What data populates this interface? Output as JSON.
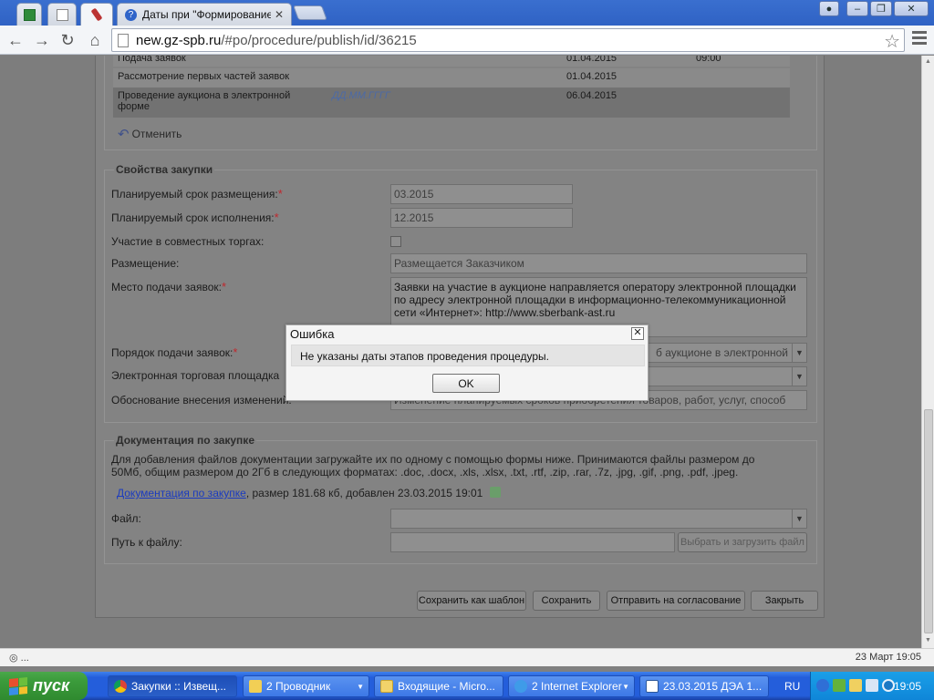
{
  "browser": {
    "tabs": [
      {
        "title": "",
        "icon": "spreadsheet-icon"
      },
      {
        "title": "",
        "icon": "page-icon"
      },
      {
        "title": "",
        "icon": "tools-icon"
      },
      {
        "title": "Даты при \"Формирование и",
        "icon": "help-icon"
      }
    ],
    "url_host": "new.gz-spb.ru",
    "url_path": "/#po/procedure/publish/id/36215"
  },
  "stages": {
    "rows": [
      {
        "name": "Подача заявок",
        "date": "01.04.2015",
        "time": "09:00",
        "selected": false
      },
      {
        "name": "Рассмотрение первых частей заявок",
        "date": "01.04.2015",
        "time": "",
        "selected": false
      },
      {
        "name": "Проведение аукциона в электронной форме",
        "date": "06.04.2015",
        "time": "",
        "selected": true,
        "hint": "ДД.ММ.ГГГГ"
      }
    ],
    "cancel_label": "Отменить"
  },
  "properties": {
    "legend": "Свойства закупки",
    "planned_placement_label": "Планируемый срок размещения:",
    "planned_placement_value": "03.2015",
    "planned_execution_label": "Планируемый срок исполнения:",
    "planned_execution_value": "12.2015",
    "joint_label": "Участие в совместных торгах:",
    "placement_label": "Размещение:",
    "placement_value": "Размещается Заказчиком",
    "place_label": "Место подачи заявок:",
    "place_value": "Заявки на участие в аукционе направляется оператору электронной площадки по адресу электронной площадки в информационно-телекоммуникационной сети «Интернет»: http://www.sberbank-ast.ru",
    "order_label": "Порядок подачи заявок:",
    "order_value": "б аукционе в электронной",
    "platform_label": "Электронная торговая площадка",
    "reason_label": "Обоснование внесения изменений:",
    "reason_value": "Изменение планируемых сроков приобретения товаров, работ, услуг, способ"
  },
  "docs": {
    "legend": "Документация по закупке",
    "info": "Для добавления файлов документации загружайте их по одному с помощью формы ниже. Принимаются файлы размером до 50Мб, общим размером до 2Гб в следующих форматах: .doc, .docx, .xls, .xlsx, .txt, .rtf, .zip, .rar, .7z, .jpg, .gif, .png, .pdf, .jpeg.",
    "link_text": "Документация по закупке",
    "link_meta": ", размер 181.68 кб, добавлен 23.03.2015 19:01",
    "file_label": "Файл:",
    "path_label": "Путь к файлу:",
    "upload_label": "Выбрать и загрузить файл"
  },
  "actions": {
    "save_template": "Сохранить как шаблон",
    "save": "Сохранить",
    "send": "Отправить на согласование",
    "close": "Закрыть"
  },
  "modal": {
    "title": "Ошибка",
    "message": "Не указаны даты этапов проведения процедуры.",
    "ok": "OK"
  },
  "statusbar": {
    "left": "◎ ...",
    "right": "23 Март 19:05"
  },
  "taskbar": {
    "start": "пуск",
    "tasks": [
      {
        "label": "Закупки :: Извещ...",
        "active": true
      },
      {
        "label": "2 Проводник",
        "active": false
      },
      {
        "label": "Входящие - Micro...",
        "active": false
      },
      {
        "label": "2 Internet Explorer",
        "active": false
      },
      {
        "label": "23.03.2015 ДЭА 1...",
        "active": false
      }
    ],
    "lang": "RU",
    "clock": "19:05"
  },
  "colors": {
    "xp_blue": "#245edb",
    "start_green": "#3c9c3c",
    "required": "#c0272d",
    "link": "#1b3bbf"
  }
}
